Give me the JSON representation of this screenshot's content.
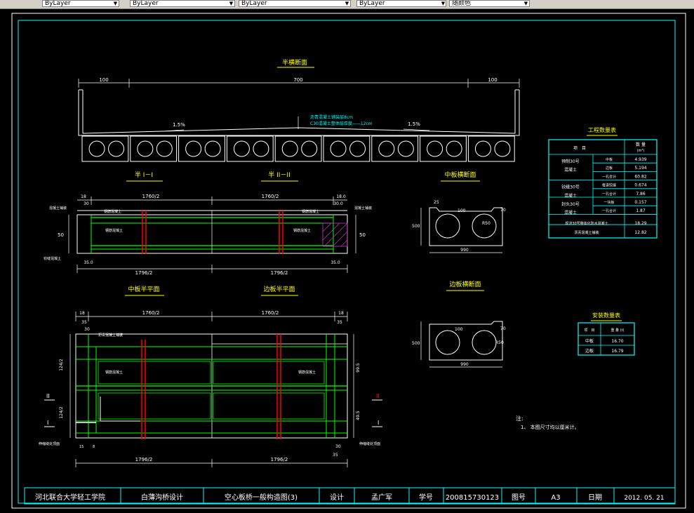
{
  "toolbar": {
    "combos": [
      {
        "value": "ByLayer"
      },
      {
        "value": "ByLayer"
      },
      {
        "value": "ByLayer"
      },
      {
        "value": "随颜色"
      }
    ]
  },
  "colors": {
    "frame": "#00ffff",
    "structure": "#ffffff",
    "rebar": "#00ff00",
    "cut": "#ff0000",
    "title": "#ffff00",
    "dim": "#ffffff",
    "hatch": "#cc33cc"
  },
  "drawing": {
    "top_section": {
      "title": "半横断面",
      "dim_left": "100",
      "dim_mid": "700",
      "dim_right": "100",
      "slope_left": "1.5%",
      "slope_right": "1.5%",
      "note1": "沥青混凝土铺装层8cm",
      "note2": "C30混凝土整体层厚度——12cm"
    },
    "half_section_1": {
      "title": "半 I－I",
      "dim_top": "1760/2",
      "dim_bottom": "1796/2",
      "dim_left_top": "18",
      "dim_left_2": "30",
      "dim_side": "50",
      "dim_bottom_left": "35.0",
      "label_a": "混凝土铺装",
      "label_b": "钢筋混凝土",
      "label_c": "钢筋混凝土",
      "label_d": "铰缝混凝土"
    },
    "half_section_2": {
      "title": "半 II－II",
      "dim_top": "1760/2",
      "dim_bottom": "1796/2",
      "dim_right_top": "18.0",
      "dim_right_2": "30.0",
      "dim_side": "50",
      "dim_bottom_right": "35.0",
      "label_a": "混凝土铺装",
      "label_b": "钢筋混凝土"
    },
    "mid_slab_section": {
      "title": "中板横断面",
      "dim_top_left": "25",
      "dim_hole": "100",
      "dim_right_top": "70",
      "dim_radius": "R50",
      "dim_height": "500",
      "dim_width": "990"
    },
    "edge_slab_section": {
      "title": "边板横断面",
      "dim_hole": "100",
      "dim_right_top": "70",
      "dim_radius": "R50",
      "dim_height": "500",
      "dim_width": "990"
    },
    "mid_half_plan": {
      "title": "中板半平面",
      "dim_top": "1760/2",
      "dim_bottom": "1796/2",
      "dim_left_1": "18",
      "dim_left_2": "35",
      "dim_left_3": "30",
      "dim_vert_1": "124/2",
      "dim_vert_2": "124/2",
      "label_a": "沥青混凝土铺装",
      "label_b": "钢筋混凝土",
      "label_c": "伸缩缝处顶面",
      "section_mark_2": "II",
      "section_mark_1": "I",
      "dim_small_1": "15",
      "dim_small_2": "8"
    },
    "edge_half_plan": {
      "title": "边板半平面",
      "dim_top": "1760/2",
      "dim_bottom": "1796/2",
      "dim_right_1": "18",
      "dim_right_2": "35",
      "dim_vert_1": "99.5",
      "dim_vert_2": "49.5",
      "label_a": "钢筋混凝土",
      "label_b": "伸缩缝处顶面",
      "section_mark_2": "II",
      "section_mark_1": "I",
      "dim_r1": "30",
      "dim_r2": "35"
    },
    "quantity_table": {
      "title": "工程数量表",
      "header_item": "项　目",
      "header_qty": "数 量",
      "header_unit": "(m³)",
      "rows": [
        {
          "group": "预制30号",
          "sub": "中板",
          "val": "4.939"
        },
        {
          "group": "混凝土",
          "sub": "边板",
          "val": "5.194"
        },
        {
          "group": "",
          "sub": "一孔合计",
          "val": "60.82"
        },
        {
          "group": "铰缝30号",
          "sub": "每道铰缝",
          "val": "0.674"
        },
        {
          "group": "混凝土",
          "sub": "一孔合计",
          "val": "7.86"
        },
        {
          "group": "封头30号",
          "sub": "一块板",
          "val": "0.157"
        },
        {
          "group": "混凝土",
          "sub": "一孔合计",
          "val": "1.87"
        }
      ],
      "row_full_1_label": "现浇30号整体化防水混凝土",
      "row_full_1_val": "18.29",
      "row_full_2_label": "沥青混凝土铺装",
      "row_full_2_val": "12.82"
    },
    "weight_table": {
      "title": "安装数量表",
      "header_item": "项　目",
      "header_qty": "重 量 (t)",
      "rows": [
        {
          "name": "中板",
          "val": "16.70"
        },
        {
          "name": "边板",
          "val": "16.79"
        }
      ]
    },
    "notes": {
      "heading": "注:",
      "line1": "1、 本图尺寸均以厘米计。"
    }
  },
  "title_block": {
    "school": "河北联合大学轻工学院",
    "course": "白薄沟桥设计",
    "drawing_name": "空心板桥一般构造图(3)",
    "design_label": "设计",
    "designer": "孟广军",
    "id_label": "学号",
    "student_id": "200815730123",
    "sheet_label": "图号",
    "sheet": "A3",
    "date_label": "日期",
    "date": "2012. 05. 21"
  }
}
